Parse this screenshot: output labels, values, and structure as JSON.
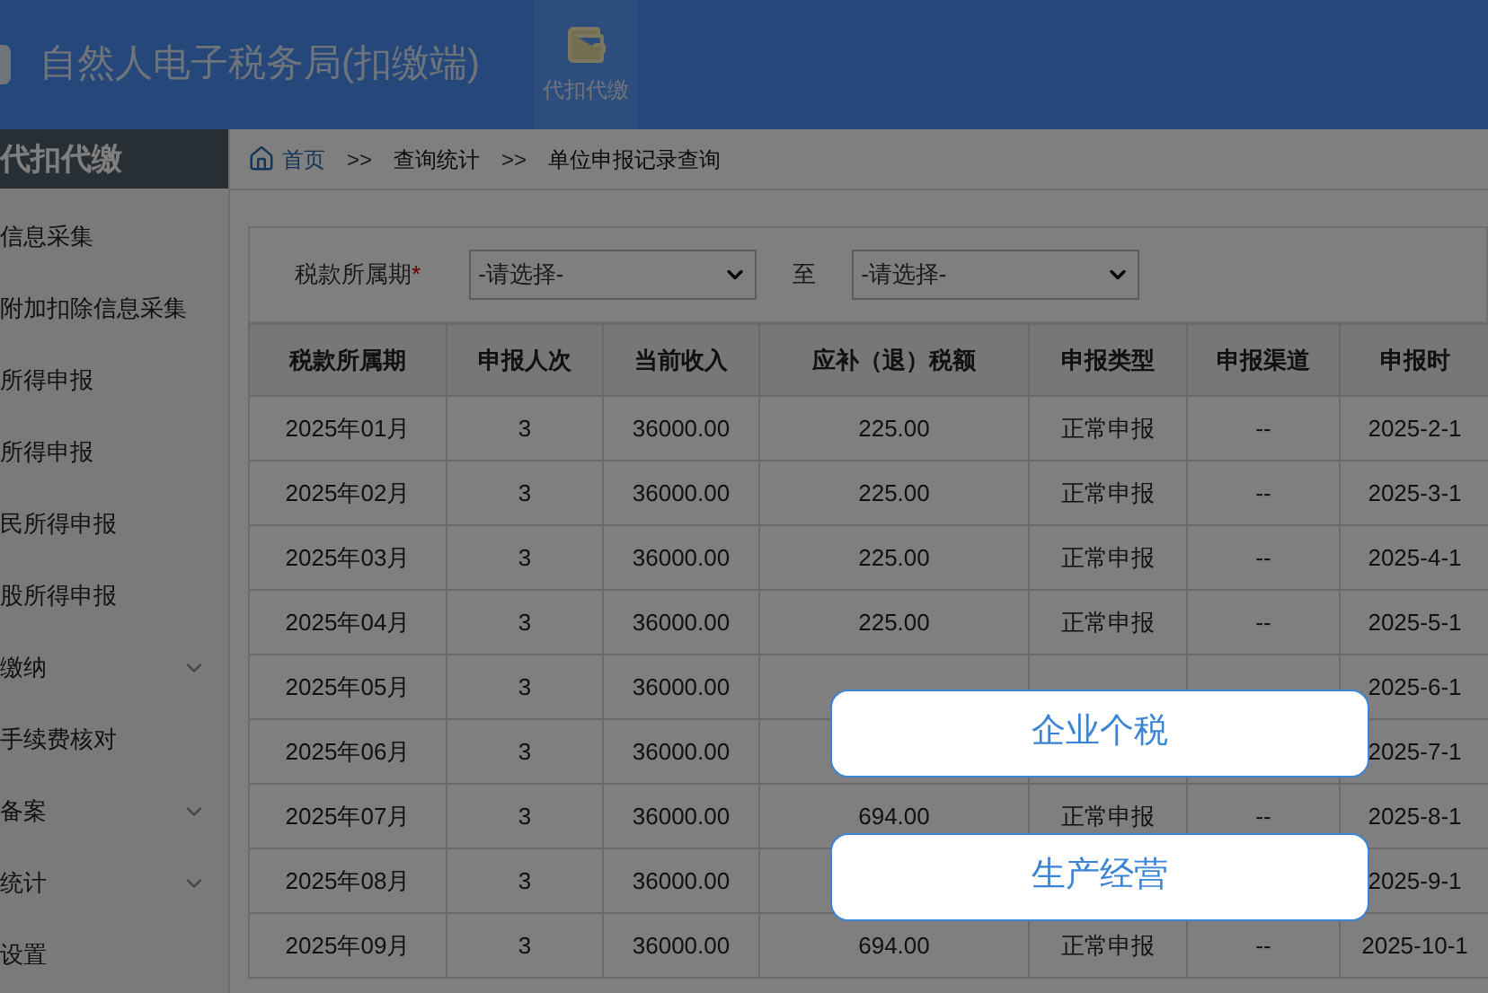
{
  "header": {
    "title": "自然人电子税务局(扣缴端)",
    "toolbar": [
      {
        "label": "代扣代缴"
      }
    ]
  },
  "sidebar": {
    "title": "代扣代缴",
    "items": [
      {
        "label": "信息采集",
        "expandable": false
      },
      {
        "label": "附加扣除信息采集",
        "expandable": false
      },
      {
        "label": "所得申报",
        "expandable": false
      },
      {
        "label": "所得申报",
        "expandable": false
      },
      {
        "label": "民所得申报",
        "expandable": false
      },
      {
        "label": "股所得申报",
        "expandable": false
      },
      {
        "label": "缴纳",
        "expandable": true
      },
      {
        "label": "手续费核对",
        "expandable": false
      },
      {
        "label": "备案",
        "expandable": true
      },
      {
        "label": "统计",
        "expandable": true
      },
      {
        "label": "设置",
        "expandable": false
      }
    ]
  },
  "breadcrumb": {
    "home": "首页",
    "separators": [
      ">>",
      ">>"
    ],
    "items": [
      "查询统计",
      "单位申报记录查询"
    ]
  },
  "filter": {
    "label": "税款所属期",
    "required_mark": "*",
    "from": {
      "value": "-请选择-"
    },
    "to_label": "至",
    "to": {
      "value": "-请选择-"
    }
  },
  "table": {
    "columns": [
      "税款所属期",
      "申报人次",
      "当前收入",
      "应补（退）税额",
      "申报类型",
      "申报渠道",
      "申报时"
    ],
    "rows": [
      {
        "period": "2025年01月",
        "count": "3",
        "income": "36000.00",
        "tax": "225.00",
        "type": "正常申报",
        "channel": "--",
        "time": "2025-2-1"
      },
      {
        "period": "2025年02月",
        "count": "3",
        "income": "36000.00",
        "tax": "225.00",
        "type": "正常申报",
        "channel": "--",
        "time": "2025-3-1"
      },
      {
        "period": "2025年03月",
        "count": "3",
        "income": "36000.00",
        "tax": "225.00",
        "type": "正常申报",
        "channel": "--",
        "time": "2025-4-1"
      },
      {
        "period": "2025年04月",
        "count": "3",
        "income": "36000.00",
        "tax": "225.00",
        "type": "正常申报",
        "channel": "--",
        "time": "2025-5-1"
      },
      {
        "period": "2025年05月",
        "count": "3",
        "income": "36000.00",
        "time": "2025-6-1"
      },
      {
        "period": "2025年06月",
        "count": "3",
        "income": "36000.00",
        "time": "2025-7-1"
      },
      {
        "period": "2025年07月",
        "count": "3",
        "income": "36000.00",
        "tax": "694.00",
        "type": "正常申报",
        "channel": "--",
        "time": "2025-8-1"
      },
      {
        "period": "2025年08月",
        "count": "3",
        "income": "36000.00",
        "time": "2025-9-1"
      },
      {
        "period": "2025年09月",
        "count": "3",
        "income": "36000.00",
        "tax": "694.00",
        "type": "正常申报",
        "channel": "--",
        "time": "2025-10-1"
      }
    ]
  },
  "popup": {
    "options": [
      "企业个税",
      "生产经营"
    ]
  }
}
